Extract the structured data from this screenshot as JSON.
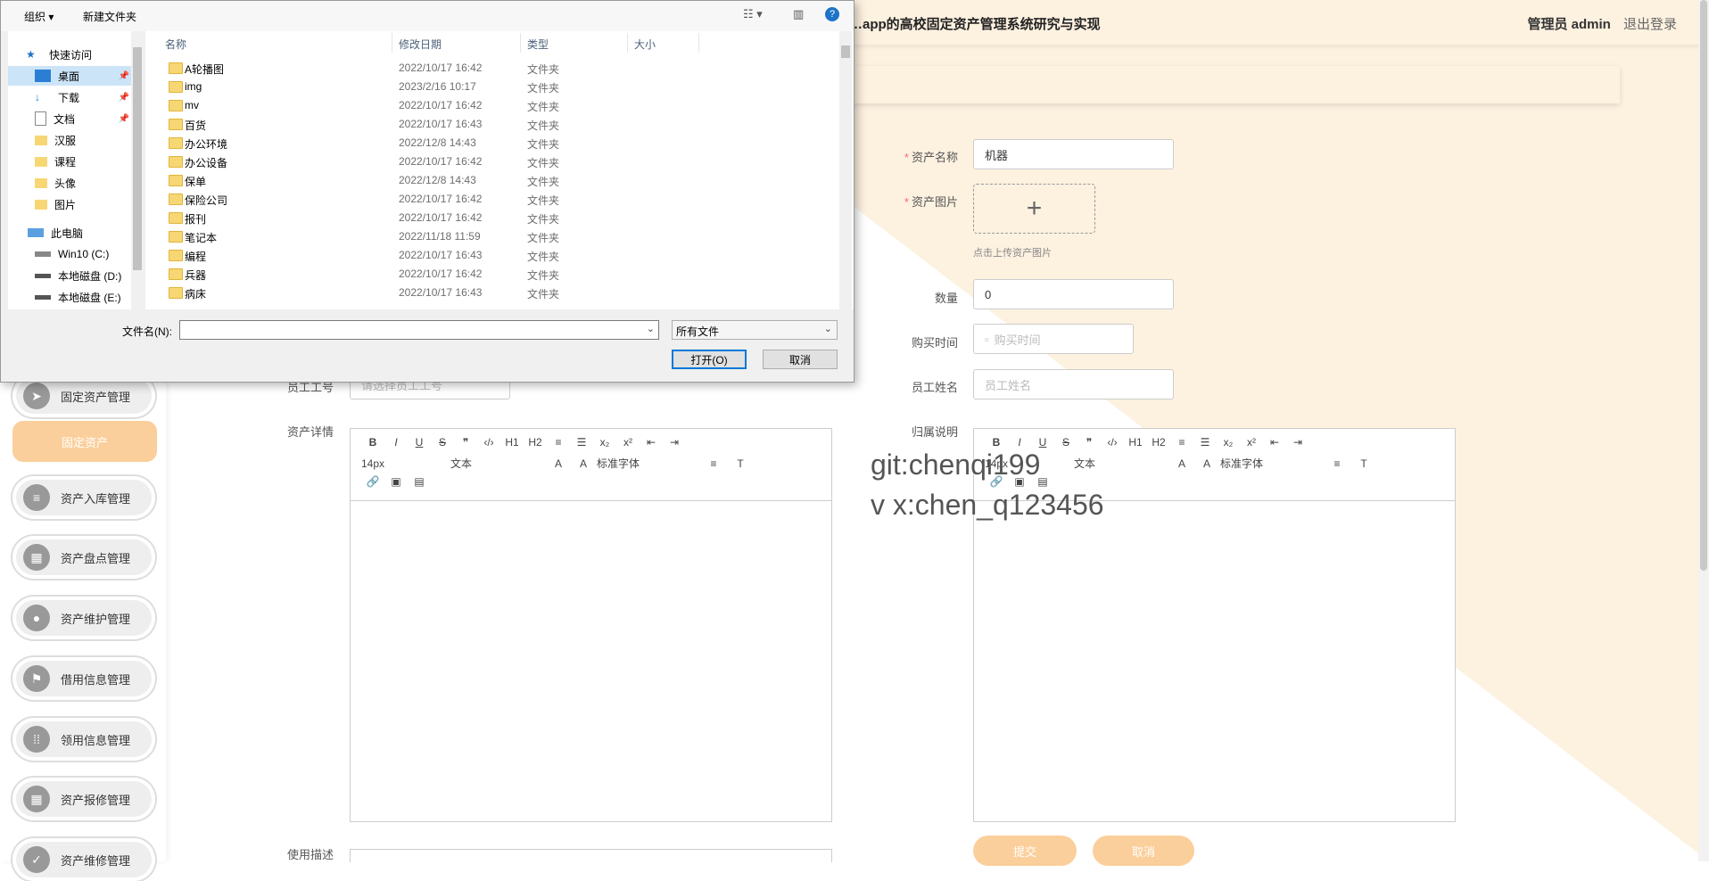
{
  "app": {
    "title": "…app的高校固定资产管理系统研究与实现",
    "user_name": "管理员 admin",
    "logout_label": "退出登录"
  },
  "sidebar": {
    "items": [
      {
        "label": "固定资产管理",
        "icon": "send-icon"
      },
      {
        "label": "固定资产",
        "sub": true
      },
      {
        "label": "资产入库管理",
        "icon": "sliders-icon"
      },
      {
        "label": "资产盘点管理",
        "icon": "grid-icon"
      },
      {
        "label": "资产维护管理",
        "icon": "user-icon"
      },
      {
        "label": "借用信息管理",
        "icon": "flag-icon"
      },
      {
        "label": "领用信息管理",
        "icon": "apps-icon"
      },
      {
        "label": "资产报修管理",
        "icon": "grid-icon"
      },
      {
        "label": "资产维修管理",
        "icon": "check-icon"
      }
    ]
  },
  "form": {
    "asset_name_label": "资产名称",
    "asset_name_value": "机器",
    "asset_image_label": "资产图片",
    "upload_plus": "+",
    "upload_hint": "点击上传资产图片",
    "quantity_label": "数量",
    "quantity_value": "0",
    "purchase_time_label": "购买时间",
    "purchase_time_placeholder": "购买时间",
    "employee_name_label": "员工姓名",
    "employee_name_placeholder": "员工姓名",
    "employee_no_label": "员工工号",
    "employee_no_placeholder": "请选择员工工号",
    "asset_detail_label": "资产详情",
    "ownership_label": "归属说明",
    "usage_label": "使用描述",
    "submit_label": "提交",
    "cancel_label": "取消"
  },
  "editor_toolbar": {
    "row1": [
      "B",
      "I",
      "U",
      "S",
      "❞",
      "‹/›",
      "H1",
      "H2",
      "≡",
      "☰",
      "x₂",
      "x²",
      "⇤",
      "⇥"
    ],
    "font_size": "14px",
    "text_style": "文本",
    "font_family": "标准字体"
  },
  "watermark": {
    "line1": "git:chenqi199",
    "line2": "v x:chen_q123456"
  },
  "dialog": {
    "organize_label": "组织 ▾",
    "new_folder_label": "新建文件夹",
    "nav": [
      {
        "label": "快速访问",
        "icon": "star-icon"
      },
      {
        "label": "桌面",
        "icon": "desktop-icon",
        "selected": true,
        "pinned": true
      },
      {
        "label": "下载",
        "icon": "download-icon",
        "pinned": true
      },
      {
        "label": "文档",
        "icon": "document-icon",
        "pinned": true
      },
      {
        "label": "汉服",
        "icon": "folder-icon"
      },
      {
        "label": "课程",
        "icon": "folder-icon"
      },
      {
        "label": "头像",
        "icon": "folder-icon"
      },
      {
        "label": "图片",
        "icon": "folder-icon"
      },
      {
        "label": "此电脑",
        "icon": "computer-icon"
      },
      {
        "label": "Win10 (C:)",
        "icon": "drive-icon"
      },
      {
        "label": "本地磁盘 (D:)",
        "icon": "drive-icon"
      },
      {
        "label": "本地磁盘 (E:)",
        "icon": "drive-icon"
      }
    ],
    "columns": {
      "name": "名称",
      "date": "修改日期",
      "type": "类型",
      "size": "大小"
    },
    "files": [
      {
        "name": "A轮播图",
        "date": "2022/10/17 16:42",
        "type": "文件夹"
      },
      {
        "name": "img",
        "date": "2023/2/16 10:17",
        "type": "文件夹"
      },
      {
        "name": "mv",
        "date": "2022/10/17 16:42",
        "type": "文件夹"
      },
      {
        "name": "百货",
        "date": "2022/10/17 16:43",
        "type": "文件夹"
      },
      {
        "name": "办公环境",
        "date": "2022/12/8 14:43",
        "type": "文件夹"
      },
      {
        "name": "办公设备",
        "date": "2022/10/17 16:42",
        "type": "文件夹"
      },
      {
        "name": "保单",
        "date": "2022/12/8 14:43",
        "type": "文件夹"
      },
      {
        "name": "保险公司",
        "date": "2022/10/17 16:42",
        "type": "文件夹"
      },
      {
        "name": "报刊",
        "date": "2022/10/17 16:42",
        "type": "文件夹"
      },
      {
        "name": "笔记本",
        "date": "2022/11/18 11:59",
        "type": "文件夹"
      },
      {
        "name": "编程",
        "date": "2022/10/17 16:43",
        "type": "文件夹"
      },
      {
        "name": "兵器",
        "date": "2022/10/17 16:42",
        "type": "文件夹"
      },
      {
        "name": "病床",
        "date": "2022/10/17 16:43",
        "type": "文件夹"
      }
    ],
    "filename_label": "文件名(N):",
    "filename_value": "",
    "filetype_value": "所有文件",
    "open_label": "打开(O)",
    "cancel_label": "取消"
  }
}
